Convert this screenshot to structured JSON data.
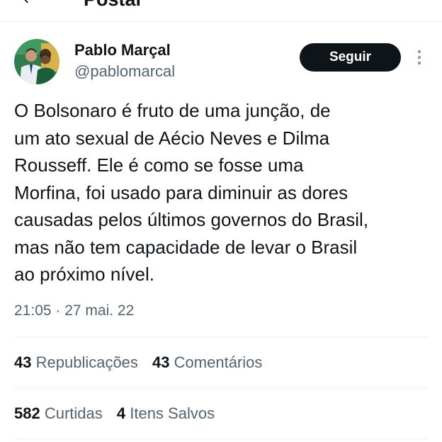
{
  "header": {
    "title": "Postar"
  },
  "tweet": {
    "author_name": "Pablo Marçal",
    "author_handle": "@pablomarcal",
    "follow_label": "Seguir",
    "lines": [
      "O Bolsonaro é fruto de uma junção, de",
      "um ato sexual de Aécio Neves e Dilma",
      "Rousseff. Ele é como se fosse uma",
      "Morfina, foi usado para diminuir as dores",
      "causadas pelos últimos governos do Brasil,",
      "mas não tem capacidade de levar o Brasil",
      "ao próximo nível."
    ],
    "timestamp": "21:05 · 27 mai. 22"
  },
  "stats": {
    "reposts_count": "43",
    "reposts_label": "Republicações",
    "comments_count": "43",
    "comments_label": "Comentários",
    "likes_count": "582",
    "likes_label": "Curtidas",
    "saves_count": "4",
    "saves_label": "Itens Salvos"
  },
  "colors": {
    "text_primary": "#0f1419",
    "text_secondary": "#536471",
    "button_bg": "#0f1419",
    "divider": "#eff3f4"
  },
  "icons": {
    "back": "arrow-left-icon",
    "more": "more-vertical-icon"
  }
}
